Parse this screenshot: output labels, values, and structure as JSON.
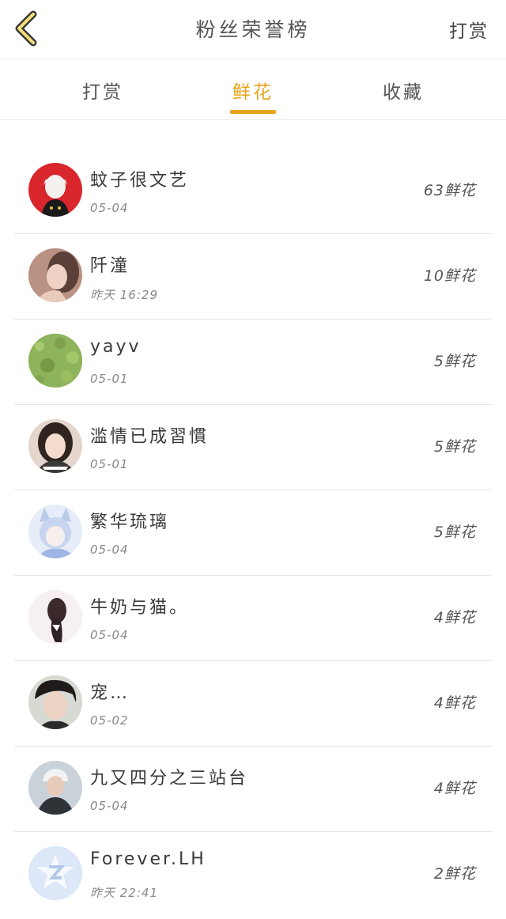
{
  "header": {
    "back_icon": "chevron-left-icon",
    "title": "粉丝荣誉榜",
    "action_label": "打赏"
  },
  "tabs": [
    {
      "label": "打赏",
      "active": false
    },
    {
      "label": "鲜花",
      "active": true
    },
    {
      "label": "收藏",
      "active": false
    }
  ],
  "accent_color": "#e8a21c",
  "fans": [
    {
      "name": "蚊子很文艺",
      "time": "05-04",
      "count": "63鲜花"
    },
    {
      "name": "阡潼",
      "time": "昨天 16:29",
      "count": "10鲜花"
    },
    {
      "name": "yayv",
      "time": "05-01",
      "count": "5鲜花"
    },
    {
      "name": "滥情已成習慣",
      "time": "05-01",
      "count": "5鲜花"
    },
    {
      "name": "繁华琉璃",
      "time": "05-04",
      "count": "5鲜花"
    },
    {
      "name": "牛奶与猫。",
      "time": "05-04",
      "count": "4鲜花"
    },
    {
      "name": "宠…",
      "time": "05-02",
      "count": "4鲜花"
    },
    {
      "name": "九又四分之三站台",
      "time": "05-04",
      "count": "4鲜花"
    },
    {
      "name": "Forever.LH",
      "time": "昨天 22:41",
      "count": "2鲜花"
    }
  ]
}
